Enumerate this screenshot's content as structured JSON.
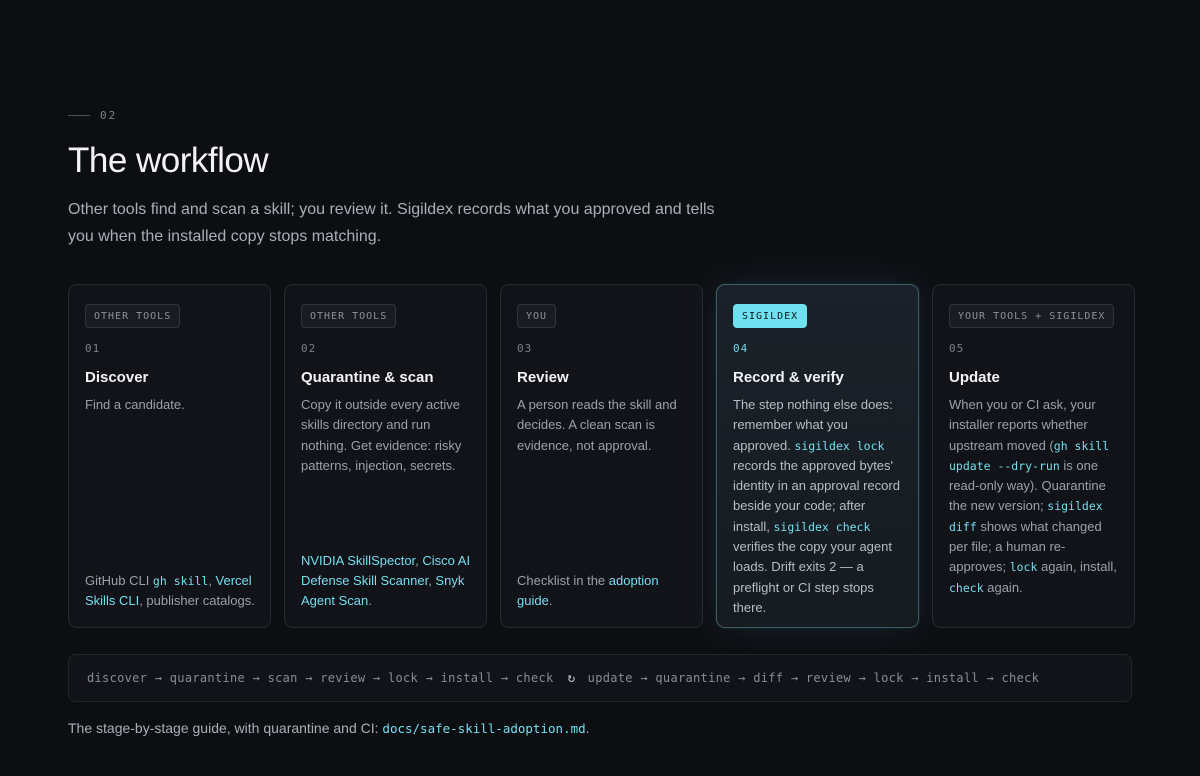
{
  "section": {
    "number": "02"
  },
  "title": "The workflow",
  "intro": "Other tools find and scan a skill; you review it. Sigildex records what you approved and tells you when the installed copy stops matching.",
  "accent_color": "#6fe0ef",
  "cards": [
    {
      "badge": "OTHER TOOLS",
      "number": "01",
      "title": "Discover",
      "desc": "Find a candidate.",
      "foot": {
        "pre": "GitHub CLI ",
        "code": "gh skill",
        "sep": ", ",
        "link": "Vercel Skills CLI",
        "post": ", publisher catalogs."
      }
    },
    {
      "badge": "OTHER TOOLS",
      "number": "02",
      "title": "Quarantine & scan",
      "desc": "Copy it outside every active skills directory and run nothing. Get evidence: risky patterns, injection, secrets.",
      "foot": {
        "link1": "NVIDIA SkillSpector",
        "sep1": ", ",
        "link2": "Cisco AI Defense Skill Scanner",
        "sep2": ", ",
        "link3": "Snyk Agent Scan",
        "post": "."
      }
    },
    {
      "badge": "YOU",
      "number": "03",
      "title": "Review",
      "desc": "A person reads the skill and decides. A clean scan is evidence, not approval.",
      "foot": {
        "pre": "Checklist in the ",
        "link": "adoption guide",
        "post": "."
      }
    },
    {
      "badge": "SIGILDEX",
      "number": "04",
      "title": "Record & verify",
      "desc": {
        "t1": "The step nothing else does: remember what you approved. ",
        "c1": "sigildex lock",
        "t2": " records the approved bytes' identity in an approval record beside your code; after install, ",
        "c2": "sigildex check",
        "t3": " verifies the copy your agent loads. Drift exits 2 — a preflight or CI step stops there."
      }
    },
    {
      "badge": "YOUR TOOLS + SIGILDEX",
      "number": "05",
      "title": "Update",
      "desc": {
        "t1": "When you or CI ask, your installer reports whether upstream moved (",
        "c1": "gh skill update --dry-run",
        "t2": " is one read-only way). Quarantine the new version; ",
        "c2": "sigildex diff",
        "t3": " shows what changed per file; a human re-approves; ",
        "c3": "lock",
        "t4": " again, install, ",
        "c4": "check",
        "t5": " again."
      }
    }
  ],
  "flow": {
    "first": "discover → quarantine → scan → review → lock → install → check",
    "cycle_icon": "↻",
    "second": "update → quarantine → diff → review → lock → install → check"
  },
  "footer": {
    "pre": "The stage-by-stage guide, with quarantine and CI: ",
    "code": "docs/safe-skill-adoption.md",
    "post": "."
  }
}
